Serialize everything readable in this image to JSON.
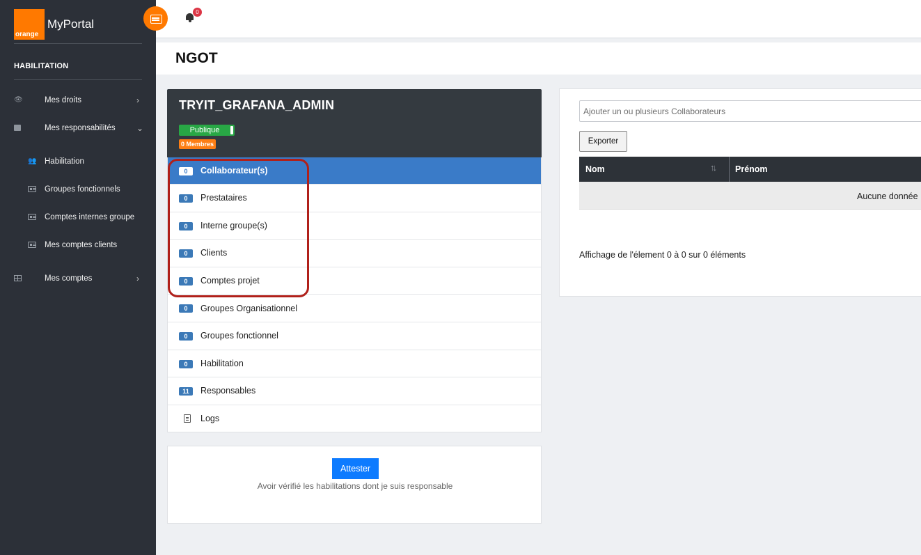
{
  "brand": {
    "logo_text": "orange",
    "app_name": "MyPortal"
  },
  "sidebar": {
    "section_title": "HABILITATION",
    "items": [
      {
        "label": "Mes droits",
        "icon": "eye-icon",
        "chevron": "›"
      },
      {
        "label": "Mes responsabilités",
        "icon": "archive-icon",
        "chevron": "⌄"
      },
      {
        "label": "Habilitation",
        "icon": "users-icon"
      },
      {
        "label": "Groupes fonctionnels",
        "icon": "id-card-icon"
      },
      {
        "label": "Comptes internes groupe",
        "icon": "id-card-icon"
      },
      {
        "label": "Mes comptes clients",
        "icon": "id-card-icon"
      },
      {
        "label": "Mes comptes",
        "icon": "table-icon",
        "chevron": "›"
      }
    ]
  },
  "topbar": {
    "notification_count": "0"
  },
  "page": {
    "title": "NGOT"
  },
  "group": {
    "name": "TRYIT_GRAFANA_ADMIN",
    "visibility": "Publique",
    "members_badge": "0 Membres",
    "rows": [
      {
        "count": "0",
        "label": "Collaborateur(s)"
      },
      {
        "count": "0",
        "label": "Prestataires"
      },
      {
        "count": "0",
        "label": "Interne groupe(s)"
      },
      {
        "count": "0",
        "label": "Clients"
      },
      {
        "count": "0",
        "label": "Comptes projet"
      },
      {
        "count": "0",
        "label": "Groupes Organisationnel"
      },
      {
        "count": "0",
        "label": "Groupes fonctionnel"
      },
      {
        "count": "0",
        "label": "Habilitation"
      },
      {
        "count": "11",
        "label": "Responsables"
      },
      {
        "count": "",
        "label": "Logs"
      }
    ]
  },
  "attest": {
    "button_label": "Attester",
    "description": "Avoir vérifié les habilitations dont je suis responsable"
  },
  "right_panel": {
    "add_placeholder": "Ajouter un ou plusieurs Collaborateurs",
    "export_label": "Exporter",
    "columns": [
      "Nom",
      "Prénom"
    ],
    "empty_text": "Aucune donnée",
    "info_text": "Affichage de l'élement 0 à 0 sur 0 éléments"
  },
  "colors": {
    "brand_orange": "#ff7900",
    "sidebar_bg": "#2c3038",
    "active_row": "#3a7bc8",
    "public_green": "#28a745",
    "highlight_red": "#b0201a",
    "primary_button": "#0d7bff"
  }
}
